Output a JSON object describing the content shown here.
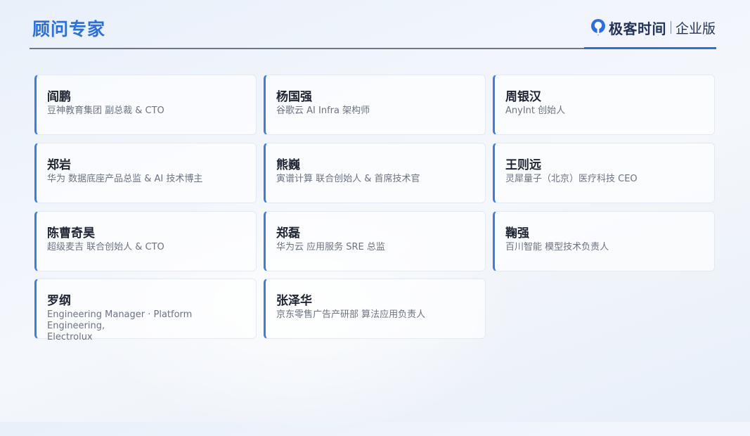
{
  "header": {
    "title": "顾问专家",
    "logo": {
      "brand": "极客时间",
      "edition": "企业版",
      "icon": "geek-time-logo-icon"
    }
  },
  "colors": {
    "accent": "#2a6fe6",
    "card_border_accent": "#3b7cec",
    "text_primary": "#1e2433",
    "text_secondary": "#6b7382"
  },
  "experts": [
    {
      "name": "阎鹏",
      "role": "豆神教育集团 副总裁 & CTO"
    },
    {
      "name": "杨国强",
      "role": "谷歌云 AI Infra 架构师"
    },
    {
      "name": "周银汉",
      "role": "AnyInt 创始人"
    },
    {
      "name": "郑岩",
      "role": "华为 数据底座产品总监 & AI 技术博主"
    },
    {
      "name": "熊巍",
      "role": "寅谱计算 联合创始人 & 首席技术官"
    },
    {
      "name": "王则远",
      "role": "灵犀量子（北京）医疗科技 CEO"
    },
    {
      "name": "陈曹奇昊",
      "role": "超级麦吉 联合创始人 & CTO"
    },
    {
      "name": "郑磊",
      "role": "华为云 应用服务 SRE 总监"
    },
    {
      "name": "鞠强",
      "role": "百川智能 模型技术负责人"
    },
    {
      "name": "罗纲",
      "role": "Engineering Manager  ·  Platform Engineering,\nElectrolux"
    },
    {
      "name": "张泽华",
      "role": "京东零售广告产研部 算法应用负责人"
    }
  ]
}
